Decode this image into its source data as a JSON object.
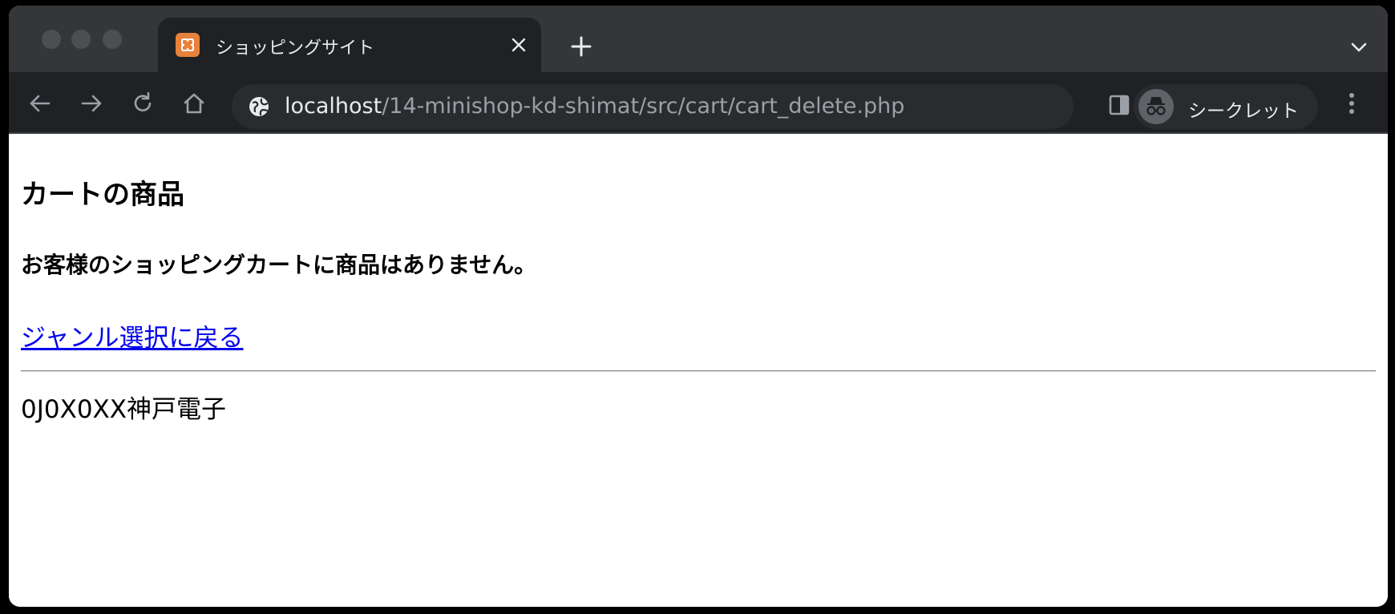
{
  "browser": {
    "tab": {
      "title": "ショッピングサイト",
      "favicon": "xampp-icon"
    },
    "address_bar": {
      "host": "localhost",
      "path": "/14-minishop-kd-shimat/src/cart/cart_delete.php"
    },
    "profile": {
      "label": "シークレット",
      "icon": "incognito-icon"
    }
  },
  "page": {
    "title": "カートの商品",
    "message": "お客様のショッピングカートに商品はありません。",
    "back_link": "ジャンル選択に戻る",
    "footer": "0J0X0XX神戸電子"
  },
  "colors": {
    "link": "#0000ee",
    "favicon": "#e6823b",
    "tabstrip": "#35363a",
    "toolbar": "#202124"
  }
}
